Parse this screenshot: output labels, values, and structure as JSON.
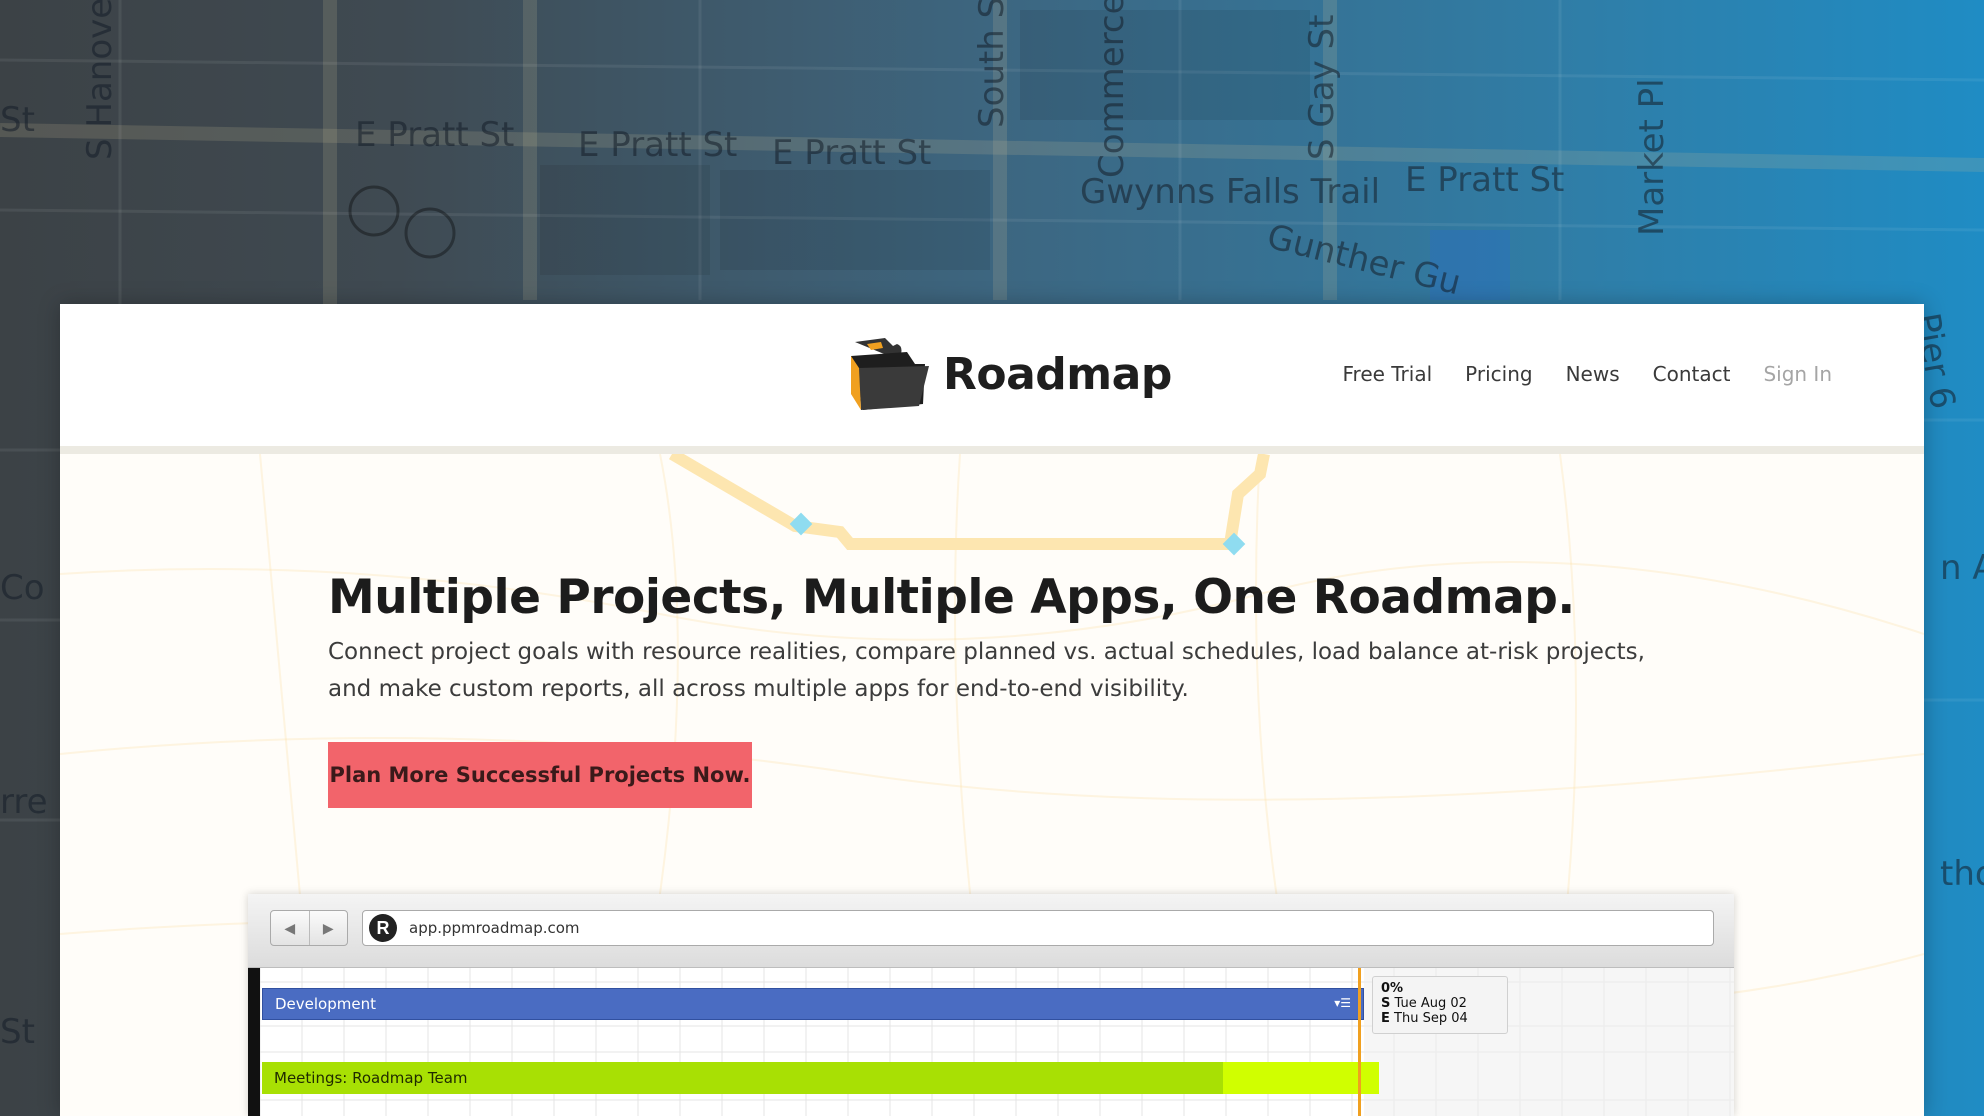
{
  "background_map": {
    "streets": [
      "St",
      "S Hanove",
      "E Pratt St",
      "E Pratt St",
      "E Pratt St",
      "South St",
      "Commerce",
      "Gwynns Falls Trail",
      "S Gay St",
      "E Pratt St",
      "Market Pl",
      "Gunther Gu",
      "Pier 6",
      "Co",
      "n Av",
      "rre",
      "St",
      "tho"
    ]
  },
  "brand": {
    "name": "Roadmap"
  },
  "nav": {
    "items": [
      {
        "label": "Free Trial"
      },
      {
        "label": "Pricing"
      },
      {
        "label": "News"
      },
      {
        "label": "Contact"
      },
      {
        "label": "Sign In"
      }
    ]
  },
  "hero": {
    "headline": "Multiple Projects, Multiple Apps, One Roadmap.",
    "subtext": "Connect project goals with resource realities, compare planned vs. actual schedules, load balance at-risk projects, and make custom reports, all across multiple apps for end-to-end visibility.",
    "cta_label": "Plan More Successful Projects Now."
  },
  "app_preview": {
    "url": "app.ppmroadmap.com",
    "url_icon_letter": "R",
    "rows": [
      {
        "label": "Development",
        "color": "#4a6cc2"
      },
      {
        "label": "Meetings: Roadmap Team",
        "color": "#a8e004"
      }
    ],
    "tooltip": {
      "percent": "0%",
      "start_key": "S",
      "start_date": "Tue Aug 02",
      "end_key": "E",
      "end_date": "Thu Sep 04"
    }
  },
  "colors": {
    "cta": "#f2646b",
    "development_bar": "#4a6cc2",
    "meetings_bar": "#a8e004"
  }
}
